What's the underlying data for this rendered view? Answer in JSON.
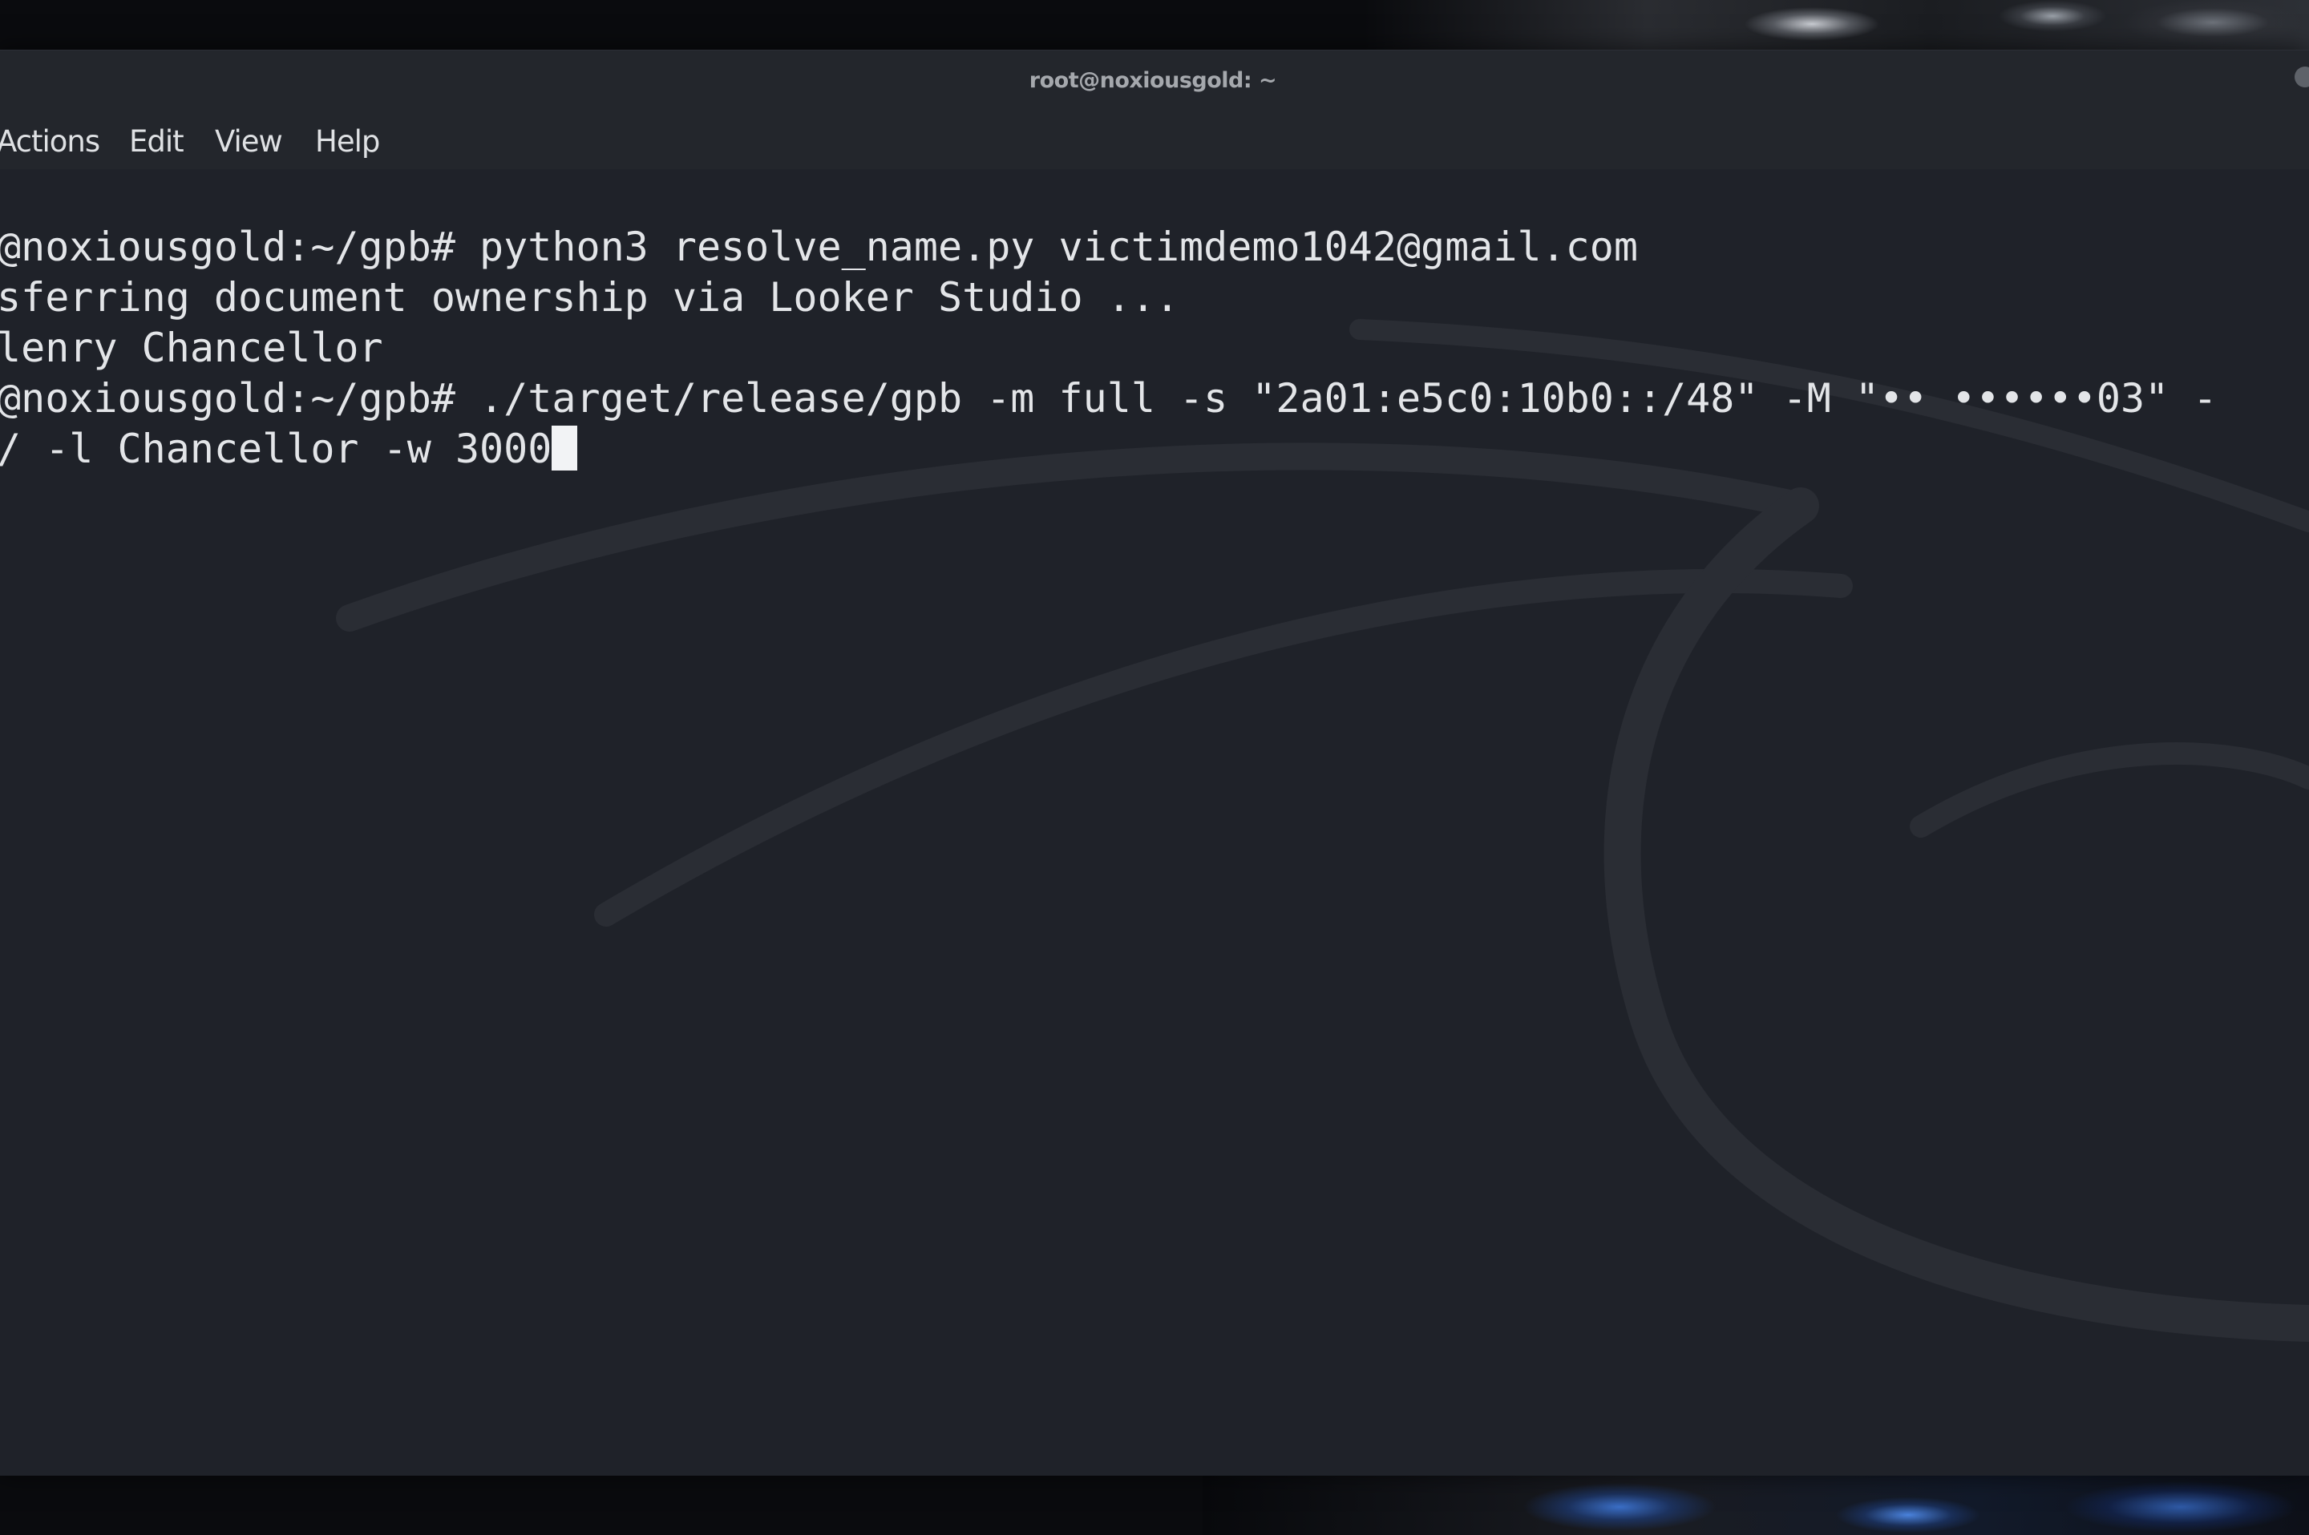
{
  "window": {
    "title": "root@noxiousgold: ~"
  },
  "menu": {
    "items": [
      {
        "label": "Actions"
      },
      {
        "label": "Edit"
      },
      {
        "label": "View"
      },
      {
        "label": "Help"
      }
    ]
  },
  "terminal": {
    "lines": [
      "@noxiousgold:~/gpb# python3 resolve_name.py victimdemo1042@gmail.com",
      "sferring document ownership via Looker Studio ...",
      "lenry Chancellor",
      "@noxiousgold:~/gpb# ./target/release/gpb -m full -s \"2a01:e5c0:10b0::/48\" -M \"•• ••••••03\" -",
      "/ -l Chancellor -w 3000"
    ]
  },
  "colors": {
    "terminal_bg": "#1f2229",
    "titlebar_bg": "#23262c",
    "text": "#e3e5e8",
    "cursor": "#f2f3f5"
  }
}
